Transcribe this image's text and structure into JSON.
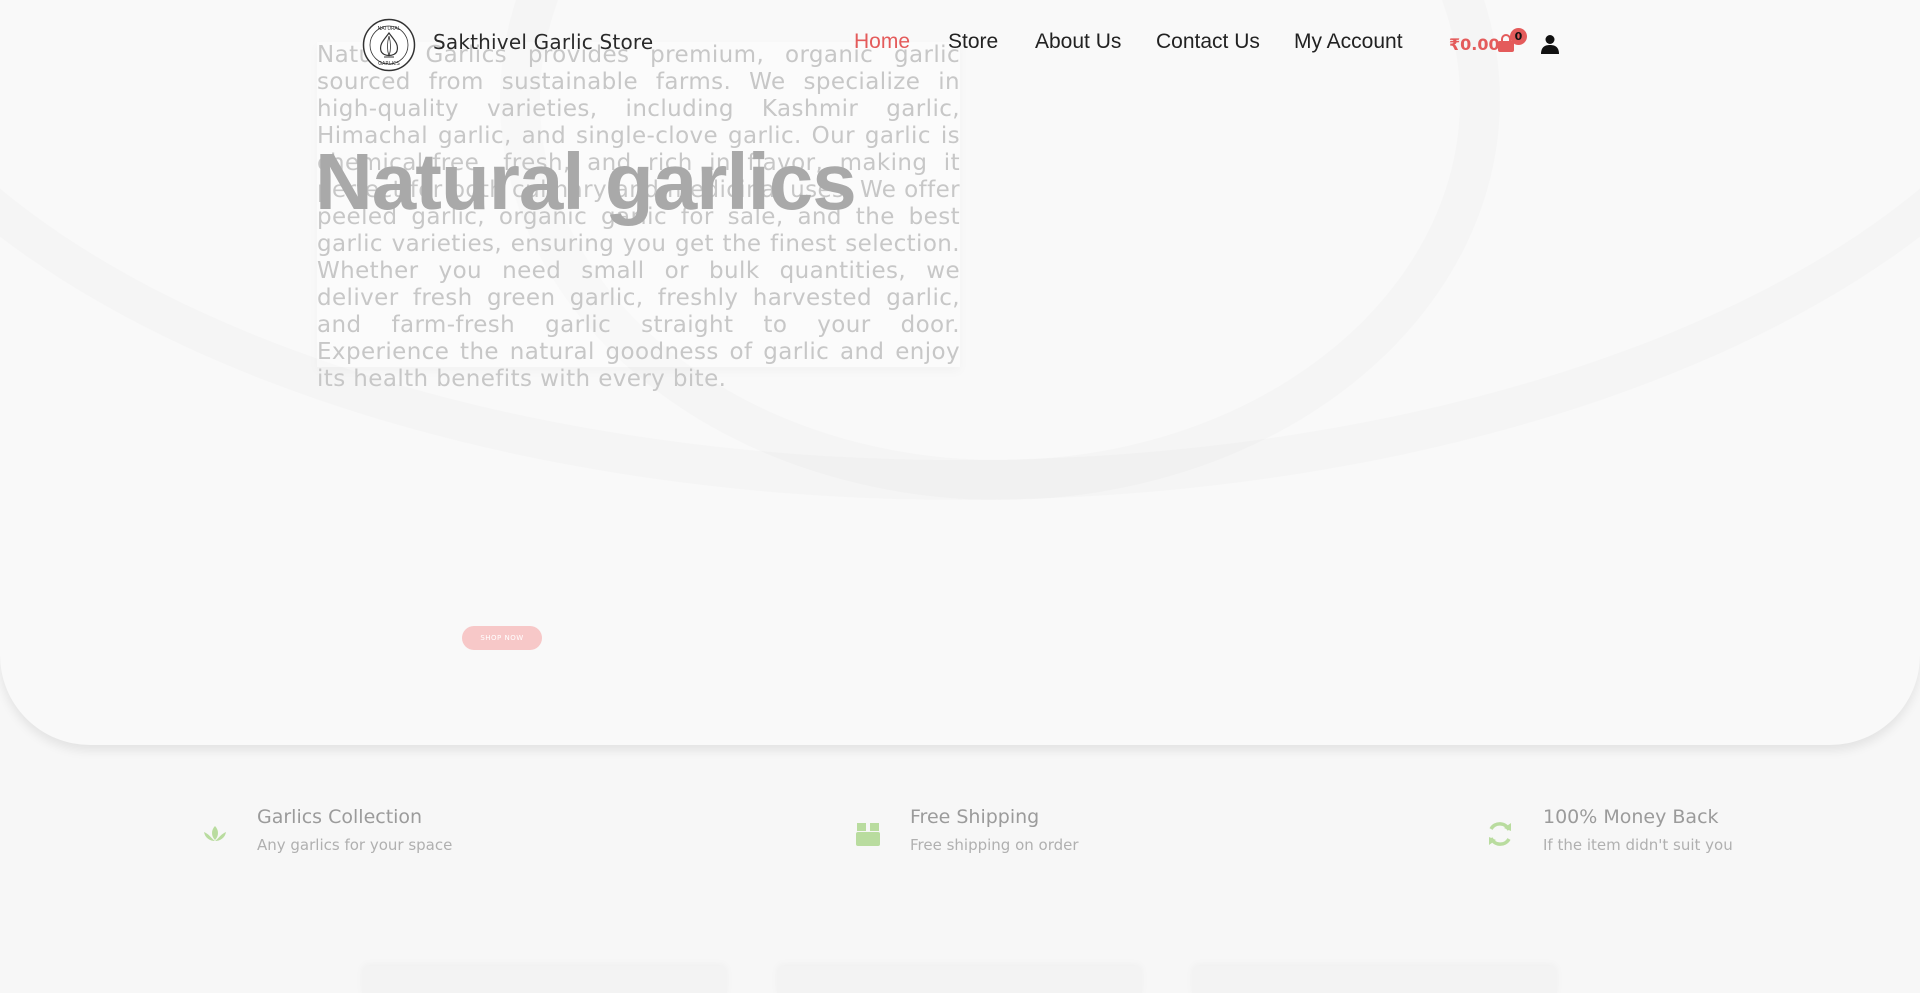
{
  "header": {
    "brand": "Sakthivel Garlic Store",
    "logo_icon": "natural-garlics-logo-icon",
    "nav": [
      "Home",
      "Store",
      "About Us",
      "Contact Us",
      "My Account"
    ],
    "active_nav": "Home",
    "cart_total": "₹0.00",
    "cart_count": "0",
    "accent_color": "#e45b5b"
  },
  "hero": {
    "title": "Natural garlics",
    "intro": "Natural Garlics provides premium, organic garlic sourced from sustainable farms. We specialize in high-quality varieties, including Kashmir garlic, Himachal garlic, and single-clove garlic. Our garlic is chemical-free, fresh, and rich in flavor, making it perfect for both culinary and medicinal uses. We offer peeled garlic, organic garlic for sale, and the best garlic varieties, ensuring you get the finest selection. Whether you need small or bulk quantities, we deliver fresh green garlic, freshly harvested garlic, and farm-fresh garlic straight to your door. Experience the natural goodness of garlic and enjoy its health benefits with every bite.",
    "button": "shop now"
  },
  "features": [
    {
      "title": "Garlics Collection",
      "subtitle": "Any garlics for your space",
      "icon": "lotus-icon"
    },
    {
      "title": "Free Shipping",
      "subtitle": "Free shipping on order",
      "icon": "box-icon"
    },
    {
      "title": "100% Money Back",
      "subtitle": "If the item didn't suit you",
      "icon": "refresh-icon"
    }
  ],
  "feature_icon_color": "#b9dc9f"
}
